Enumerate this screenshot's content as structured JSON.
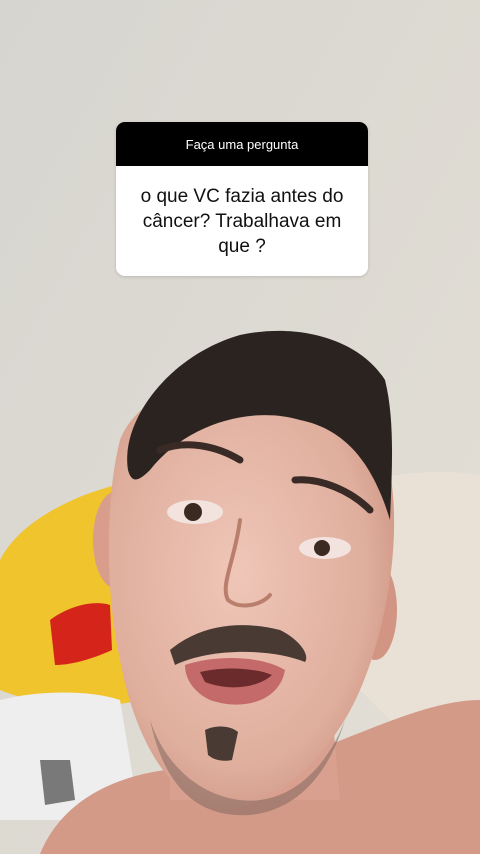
{
  "question_sticker": {
    "header": "Faça uma pergunta",
    "question": "o que VC fazia antes do câncer? Trabalhava em que ?"
  },
  "background": {
    "type": "selfie-photo",
    "wall_color": "#dad8d2",
    "pillow_color": "#f1c52d",
    "skin_color": "#e2b3a3",
    "hair_color": "#2b2320"
  }
}
